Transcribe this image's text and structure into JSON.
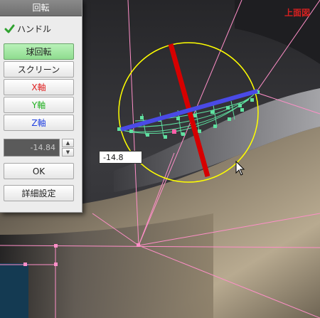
{
  "view_label": "上面図",
  "panel": {
    "title": "回転",
    "handle_checkbox": {
      "label": "ハンドル",
      "checked": true
    },
    "buttons": {
      "sphere_rotate": "球回転",
      "screen": "スクリーン",
      "x_axis": "X軸",
      "y_axis": "Y軸",
      "z_axis": "Z軸",
      "ok": "OK",
      "advanced": "詳細設定"
    },
    "angle_field": {
      "value": "-14.84"
    }
  },
  "tooltip_value": "-14.8",
  "colors": {
    "x_axis": "#e02020",
    "y_axis": "#20b020",
    "z_axis": "#2040e0",
    "gizmo_ring": "#ffff00",
    "guide_lines": "#ff8fc8",
    "view_label": "#d42020",
    "active_button": "#9fe39f"
  },
  "icons": {
    "checkbox": "checkmark-icon",
    "spin_up": "triangle-up-icon",
    "spin_down": "triangle-down-icon",
    "cursor": "mouse-pointer-icon"
  }
}
